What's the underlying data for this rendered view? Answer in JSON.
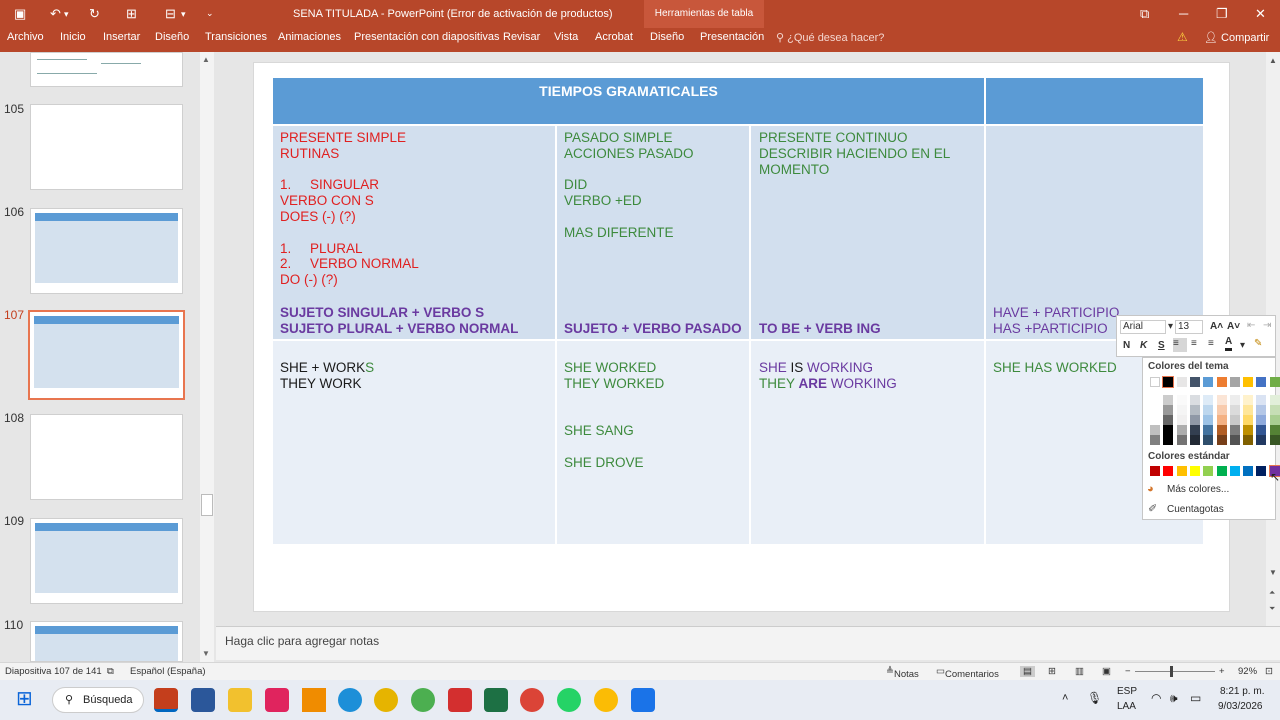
{
  "window": {
    "title": "SENA TITULADA - PowerPoint (Error de activación de productos)",
    "context_tab": "Herramientas de tabla"
  },
  "ribbon": {
    "tabs": [
      "Archivo",
      "Inicio",
      "Insertar",
      "Diseño",
      "Transiciones",
      "Animaciones",
      "Presentación con diapositivas",
      "Revisar",
      "Vista",
      "Acrobat",
      "Diseño",
      "Presentación"
    ],
    "tell_me": "¿Qué desea hacer?",
    "share": "Compartir"
  },
  "thumbnails": {
    "numbers": [
      "105",
      "106",
      "107",
      "108",
      "109",
      "110"
    ]
  },
  "table": {
    "title": "TIEMPOS GRAMATICALES",
    "row1": {
      "c1_intro": "PRESENTE SIMPLE\nRUTINAS\n\n1.     SINGULAR\nVERBO CON S\nDOES (-) (?)\n\n1.     PLURAL\n2.     VERBO NORMAL\nDO (-) (?)",
      "c1_bold": "SUJETO SINGULAR + VERBO S\nSUJETO PLURAL + VERBO NORMAL",
      "c2_intro": "PASADO SIMPLE\nACCIONES PASADO\n\nDID\nVERBO +ED\n\nMAS DIFERENTE",
      "c2_bold": "SUJETO + VERBO PASADO",
      "c3_intro": "PRESENTE CONTINUO\nDESCRIBIR HACIENDO EN EL\nMOMENTO",
      "c3_bold": "TO BE + VERB ING",
      "c4_intro": "HAVE + PARTICIPIO\nHAS +PARTICIPIO"
    },
    "row2": {
      "c1a": "SHE + WORK",
      "c1b": "S",
      "c1c": "THEY WORK",
      "c2": "SHE WORKED\nTHEY WORKED\n\n\nSHE SANG\n\nSHE DROVE",
      "c3a": "SHE ",
      "c3b": "IS",
      "c3c": " WORKING",
      "c3d": "THEY ",
      "c3e": "ARE",
      "c3f": " WORKING",
      "c4": "SHE HAS WORKED"
    }
  },
  "format_toolbar": {
    "font": "Arial",
    "size": "13",
    "bold": "N",
    "italic": "K",
    "underline": "S"
  },
  "color_palette": {
    "theme_label": "Colores del tema",
    "standard_label": "Colores estándar",
    "more_colors": "Más colores...",
    "eyedropper": "Cuentagotas",
    "theme_top": [
      "#ffffff",
      "#000000",
      "#e7e6e6",
      "#44546a",
      "#5b9bd5",
      "#ed7d31",
      "#a5a5a5",
      "#ffc000",
      "#4472c4",
      "#70ad47"
    ],
    "standard": [
      "#c00000",
      "#ff0000",
      "#ffc000",
      "#ffff00",
      "#92d050",
      "#00b050",
      "#00b0f0",
      "#0070c0",
      "#002060",
      "#7030a0"
    ]
  },
  "notes": {
    "placeholder": "Haga clic para agregar notas"
  },
  "status": {
    "slide": "Diapositiva 107 de 141",
    "lang": "Español (España)",
    "notes": "Notas",
    "comments": "Comentarios",
    "zoom": "92%"
  },
  "taskbar": {
    "search": "Búsqueda",
    "lang1": "ESP",
    "lang2": "LAA",
    "time": "8:21 p. m.",
    "date": "9/03/2026"
  }
}
